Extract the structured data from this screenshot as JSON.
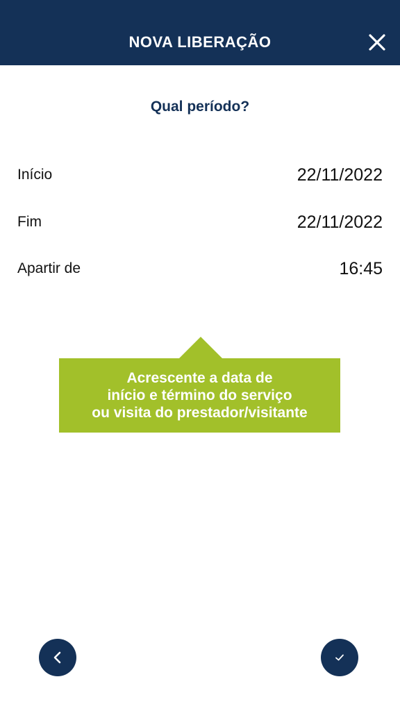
{
  "header": {
    "title": "NOVA LIBERAÇÃO",
    "close_icon": "close-icon"
  },
  "main": {
    "question": "Qual período?",
    "fields": {
      "inicio": {
        "label": "Início",
        "value": "22/11/2022"
      },
      "fim": {
        "label": "Fim",
        "value": "22/11/2022"
      },
      "apartir": {
        "label": "Apartir de",
        "value": "16:45"
      }
    }
  },
  "tip": {
    "line1": "Acrescente a data de",
    "line2": "início e término do serviço",
    "line3": "ou visita do prestador/visitante"
  },
  "footer": {
    "back_icon": "chevron-left-icon",
    "confirm_icon": "check-icon"
  },
  "colors": {
    "primary": "#143157",
    "tip_background": "#a2c02a",
    "text": "#111111",
    "white": "#ffffff"
  }
}
